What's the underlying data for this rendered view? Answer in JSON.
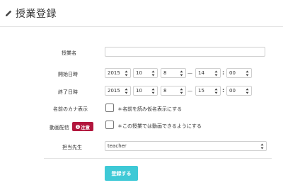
{
  "header": {
    "title": "授業登録",
    "icon": "pencil-icon"
  },
  "form": {
    "course_name": {
      "label": "授業名",
      "value": ""
    },
    "start": {
      "label": "開始日時",
      "year": "2015",
      "month": "10",
      "day": "8",
      "separator": "—",
      "hour": "14",
      "colon": ":",
      "minute": "00"
    },
    "end": {
      "label": "終了日時",
      "year": "2015",
      "month": "10",
      "day": "8",
      "separator": "—",
      "hour": "15",
      "colon": ":",
      "minute": "00"
    },
    "kana": {
      "label": "名前のカナ表示",
      "checkbox_text": "＊名前を読み仮名表示にする",
      "checked": false
    },
    "video": {
      "label": "動画配信",
      "badge": "注意",
      "badge_icon": "info-icon",
      "checkbox_text": "＊この授業では動画できるようにする",
      "checked": false
    },
    "teacher": {
      "label": "担当先生",
      "value": "teacher"
    },
    "submit_label": "登録する"
  },
  "colors": {
    "accent": "#3ec9d6",
    "badge": "#b2163d"
  }
}
